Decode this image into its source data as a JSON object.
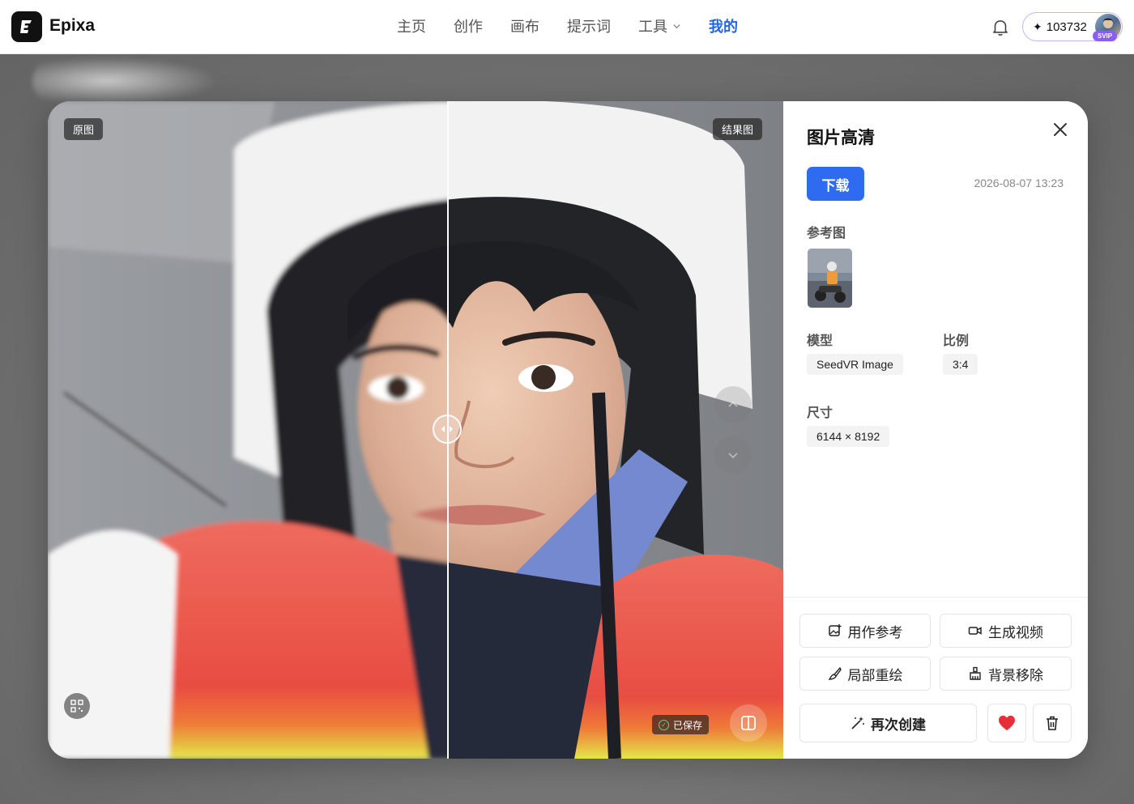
{
  "brand": {
    "name": "Epixa"
  },
  "nav": {
    "items": [
      "主页",
      "创作",
      "画布",
      "提示词",
      "工具",
      "我的"
    ],
    "active": "我的"
  },
  "account": {
    "credits": "103732",
    "badge": "SVIP"
  },
  "viewer": {
    "label_original": "原图",
    "label_result": "结果图",
    "saved_label": "已保存"
  },
  "panel": {
    "title": "图片高清",
    "download_label": "下载",
    "date": "2026-08-07 13:23",
    "reference_label": "参考图",
    "model_label": "模型",
    "model_value": "SeedVR Image",
    "ratio_label": "比例",
    "ratio_value": "3:4",
    "size_label": "尺寸",
    "size_value": "6144 × 8192"
  },
  "actions": {
    "use_as_reference": "用作参考",
    "generate_video": "生成视频",
    "inpaint": "局部重绘",
    "remove_bg": "背景移除",
    "recreate": "再次创建"
  },
  "colors": {
    "accent": "#2563eb",
    "button": "#2f6bf0",
    "favorite": "#e5303a",
    "svip": "#8b5cf6"
  }
}
